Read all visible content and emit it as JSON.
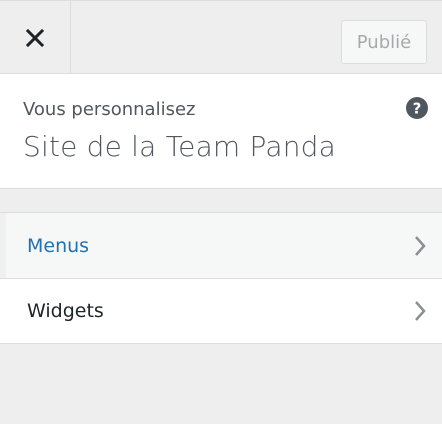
{
  "header": {
    "close_label": "Fermer",
    "publish_label": "Publié"
  },
  "info": {
    "subtitle": "Vous personnalisez",
    "site_title": "Site de la Team Panda"
  },
  "nav": {
    "items": [
      {
        "label": "Menus",
        "active": true
      },
      {
        "label": "Widgets",
        "active": false
      }
    ]
  },
  "icons": {
    "close": "close-icon",
    "help": "help-icon",
    "chevron": "chevron-right-icon"
  },
  "colors": {
    "accent": "#2271b1",
    "text": "#1d2327",
    "muted": "#a7aaad",
    "background": "#eeeeee"
  }
}
